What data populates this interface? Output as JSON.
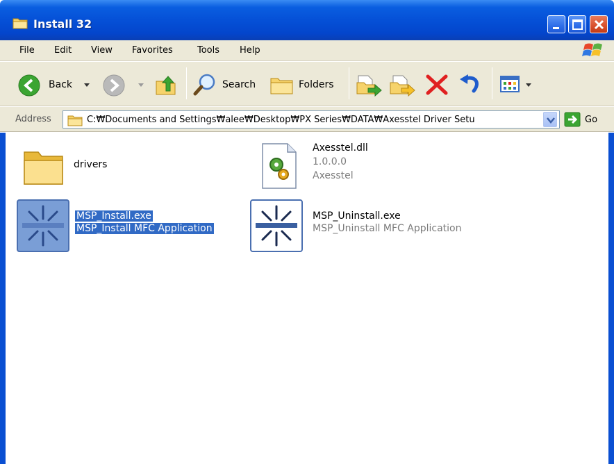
{
  "window": {
    "title": "Install 32"
  },
  "menu": {
    "items": [
      "File",
      "Edit",
      "View",
      "Favorites",
      "Tools",
      "Help"
    ]
  },
  "toolbar": {
    "back_label": "Back",
    "search_label": "Search",
    "folders_label": "Folders"
  },
  "address": {
    "label": "Address",
    "path": "C:₩Documents and Settings₩alee₩Desktop₩PX Series₩DATA₩Axesstel Driver Setu",
    "go_label": "Go"
  },
  "files": [
    {
      "name": "drivers",
      "type": "folder"
    },
    {
      "name": "Axesstel.dll",
      "line2": "1.0.0.0",
      "line3": "Axesstel",
      "type": "dll"
    },
    {
      "name": "MSP_Install.exe",
      "line2": "MSP_Install MFC Application",
      "type": "exe",
      "selected": true
    },
    {
      "name": "MSP_Uninstall.exe",
      "line2": "MSP_Uninstall MFC Application",
      "type": "exe",
      "selected": false
    }
  ],
  "colors": {
    "titlebar": "#0550d7",
    "selection": "#316ac5",
    "chrome": "#ece9d8",
    "delete_red": "#e02020"
  }
}
